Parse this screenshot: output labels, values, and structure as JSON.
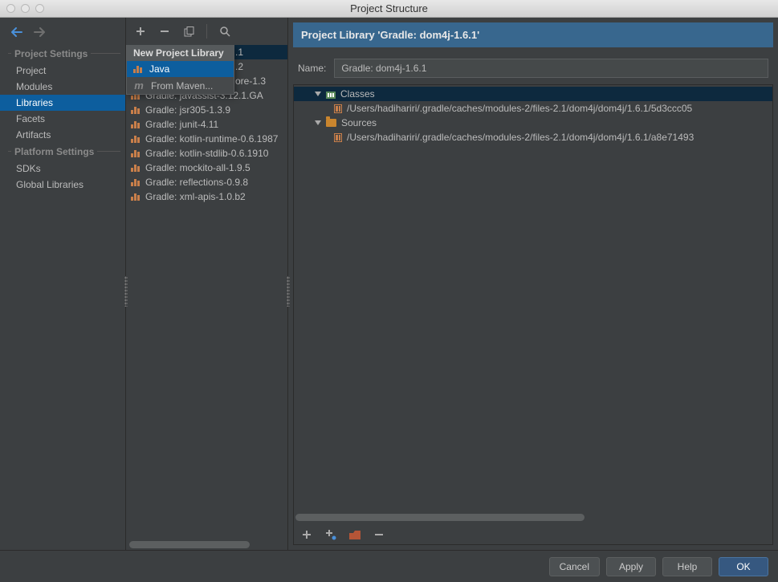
{
  "window": {
    "title": "Project Structure"
  },
  "sidebar": {
    "section1": "Project Settings",
    "section2": "Platform Settings",
    "items1": [
      {
        "label": "Project"
      },
      {
        "label": "Modules"
      },
      {
        "label": "Libraries"
      },
      {
        "label": "Facets"
      },
      {
        "label": "Artifacts"
      }
    ],
    "items2": [
      {
        "label": "SDKs"
      },
      {
        "label": "Global Libraries"
      }
    ],
    "selected": "Libraries"
  },
  "popup": {
    "title": "New Project Library",
    "items": [
      {
        "label": "Java",
        "icon": "bars"
      },
      {
        "label": "From Maven...",
        "icon": "m"
      }
    ],
    "selected": "Java"
  },
  "library_list": {
    "peek": [
      ".1",
      ".2",
      "ore-1.3"
    ],
    "items": [
      "Gradle: javassist-3.12.1.GA",
      "Gradle: jsr305-1.3.9",
      "Gradle: junit-4.11",
      "Gradle: kotlin-runtime-0.6.1987",
      "Gradle: kotlin-stdlib-0.6.1910",
      "Gradle: mockito-all-1.9.5",
      "Gradle: reflections-0.9.8",
      "Gradle: xml-apis-1.0.b2"
    ]
  },
  "details": {
    "header": "Project Library 'Gradle: dom4j-1.6.1'",
    "name_label": "Name:",
    "name_value": "Gradle: dom4j-1.6.1",
    "tree": {
      "groups": [
        {
          "label": "Classes",
          "icon": "classes",
          "children": [
            "/Users/hadihariri/.gradle/caches/modules-2/files-2.1/dom4j/dom4j/1.6.1/5d3ccc05"
          ]
        },
        {
          "label": "Sources",
          "icon": "sources",
          "children": [
            "/Users/hadihariri/.gradle/caches/modules-2/files-2.1/dom4j/dom4j/1.6.1/a8e71493"
          ]
        }
      ]
    }
  },
  "buttons": {
    "cancel": "Cancel",
    "apply": "Apply",
    "help": "Help",
    "ok": "OK"
  }
}
